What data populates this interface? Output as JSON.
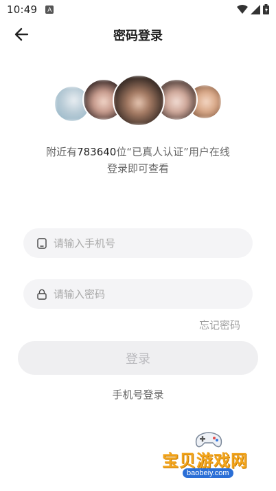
{
  "status_bar": {
    "time": "10:49",
    "app_icon_letter": "A",
    "icons": [
      "wifi-icon",
      "signal-icon",
      "battery-icon"
    ]
  },
  "nav": {
    "title": "密码登录",
    "back_icon": "arrow-left-icon"
  },
  "promo": {
    "prefix": "附近有",
    "count": "783640",
    "suffix": "位“已真人认证”用户在线",
    "line2": "登录即可查看"
  },
  "form": {
    "phone_placeholder": "请输入手机号",
    "phone_icon": "phone-icon",
    "password_placeholder": "请输入密码",
    "password_icon": "lock-icon",
    "forgot_label": "忘记密码",
    "login_label": "登录",
    "alt_login_label": "手机号登录"
  },
  "watermark": {
    "title": "宝贝游戏网",
    "url": "baobeiy.com"
  },
  "colors": {
    "input_bg": "#f4f4f6",
    "button_bg": "#efeff1",
    "button_text": "#b9b9bd",
    "muted_text": "#9e9e9e"
  }
}
